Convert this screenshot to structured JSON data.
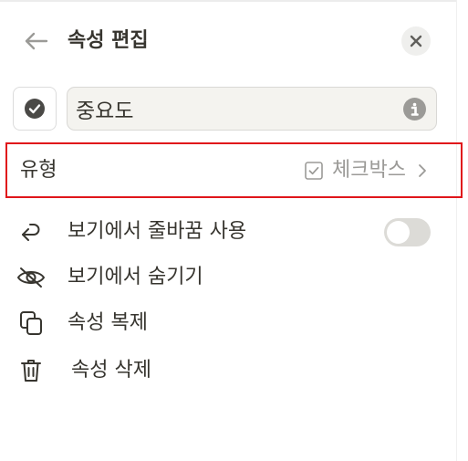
{
  "header": {
    "title": "속성 편집"
  },
  "property": {
    "name": "중요도",
    "icon": "check-circle-icon"
  },
  "type_row": {
    "label": "유형",
    "value": "체크박스"
  },
  "menu": {
    "wrap_label": "보기에서 줄바꿈 사용",
    "wrap_enabled": false,
    "hide_label": "보기에서 숨기기",
    "duplicate_label": "속성 복제",
    "delete_label": "속성 삭제"
  },
  "colors": {
    "highlight_border": "#e0161b",
    "muted_text": "#9b9a97",
    "text": "#37352f"
  }
}
